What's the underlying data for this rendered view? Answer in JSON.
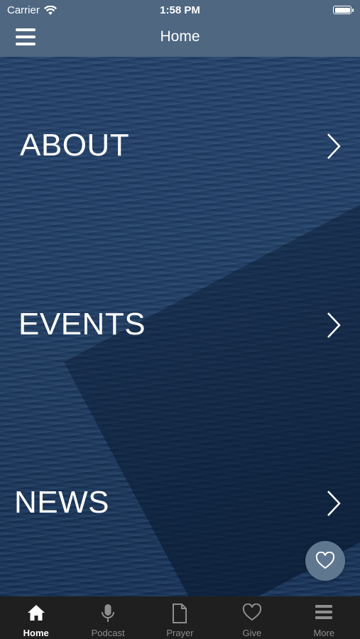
{
  "status_bar": {
    "carrier": "Carrier",
    "time": "1:58 PM"
  },
  "nav": {
    "title": "Home"
  },
  "menu_rows": [
    {
      "label": "ABOUT"
    },
    {
      "label": "EVENTS"
    },
    {
      "label": "NEWS"
    }
  ],
  "tabs": [
    {
      "label": "Home",
      "icon": "home-icon",
      "active": true
    },
    {
      "label": "Podcast",
      "icon": "microphone-icon",
      "active": false
    },
    {
      "label": "Prayer",
      "icon": "document-icon",
      "active": false
    },
    {
      "label": "Give",
      "icon": "heart-icon",
      "active": false
    },
    {
      "label": "More",
      "icon": "menu-icon",
      "active": false
    }
  ],
  "colors": {
    "header": "#4f6781",
    "tab_bar": "#1f1f1f",
    "tab_active": "#ffffff",
    "tab_inactive": "#8e8e8e",
    "fav_button": "#5f7890"
  }
}
